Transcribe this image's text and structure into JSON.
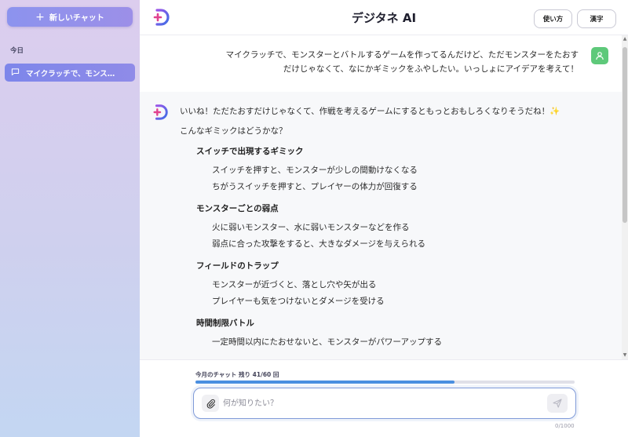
{
  "sidebar": {
    "new_chat_label": "新しいチャット",
    "section_today": "今日",
    "chats": [
      {
        "label": "マイクラッチで、モンスターとバトルするゲームを作ってるんだけど"
      }
    ]
  },
  "header": {
    "title": "デジタネ AI",
    "usage_button": "使い方",
    "kanji_button": "漢字"
  },
  "conversation": {
    "user_message_line1": "マイクラッチで、モンスターとバトルするゲームを作ってるんだけど、ただモンスターをたおす",
    "user_message_line2": "だけじゃなくて、なにかギミックをふやしたい。いっしょにアイデアを考えて！",
    "ai_intro": "いいね！ただたおすだけじゃなくて、作戦を考えるゲームにするともっとおもしろくなりそうだね！✨",
    "ai_question": "こんなギミックはどうかな？",
    "gimmicks": [
      {
        "title": "スイッチで出現するギミック",
        "lines": [
          "スイッチを押すと、モンスターが少しの間動けなくなる",
          "ちがうスイッチを押すと、プレイヤーの体力が回復する"
        ]
      },
      {
        "title": "モンスターごとの弱点",
        "lines": [
          "火に弱いモンスター、水に弱いモンスターなどを作る",
          "弱点に合った攻撃をすると、大きなダメージを与えられる"
        ]
      },
      {
        "title": "フィールドのトラップ",
        "lines": [
          "モンスターが近づくと、落とし穴や矢が出る",
          "プレイヤーも気をつけないとダメージを受ける"
        ]
      },
      {
        "title": "時間制限バトル",
        "lines": [
          "一定時間以内にたおせないと、モンスターがパワーアップする"
        ]
      }
    ]
  },
  "footer": {
    "quota_text": "今月のチャット 残り 41/60 回",
    "quota_remaining_fraction": 0.683,
    "input_placeholder": "何が知りたい？",
    "char_count": "0/1000"
  },
  "colors": {
    "accent": "#8c93ee",
    "user_avatar": "#5ec97a",
    "progress": "#4a8fe0"
  },
  "icons": {
    "new_chat": "plus-icon",
    "chat_item": "chat-bubble-icon",
    "logo": "digitane-logo-icon",
    "user": "user-icon",
    "attach": "paperclip-icon",
    "send": "send-icon"
  }
}
